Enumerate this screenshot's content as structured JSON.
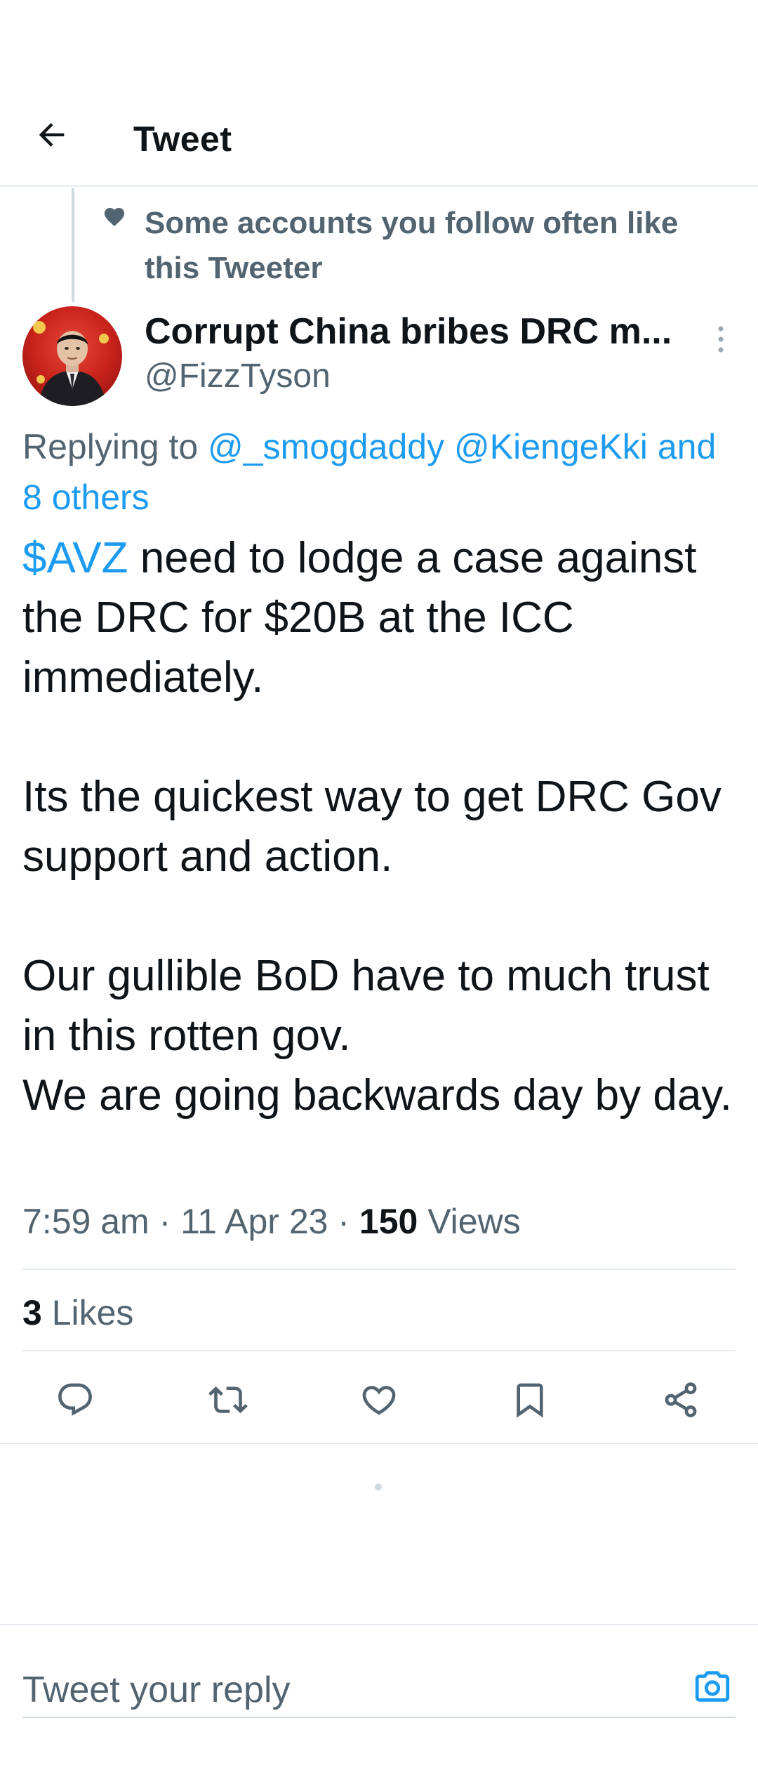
{
  "header": {
    "title": "Tweet"
  },
  "social_context": {
    "text": "Some accounts you follow often like this Tweeter",
    "icon": "heart-icon"
  },
  "author": {
    "name": "Corrupt China bribes DRC m...",
    "handle": "@FizzTyson"
  },
  "replying_to": {
    "prefix": "Replying to ",
    "mentions": [
      "@_smogdaddy",
      "@KiengeKki"
    ],
    "others": "and 8 others"
  },
  "tweet": {
    "cashtag": "$AVZ",
    "line1_rest": " need to lodge a case against the DRC for $20B at the ICC immediately.",
    "para2": "Its the quickest way to get DRC Gov support and action.",
    "para3a": "Our gullible BoD have to much trust in this rotten gov.",
    "para3b": "We are going backwards day by day."
  },
  "meta": {
    "time": "7:59 am",
    "date": "11 Apr 23",
    "separator": " · ",
    "views_count": "150",
    "views_label": " Views"
  },
  "likes": {
    "count": "3",
    "label": " Likes"
  },
  "actions": {
    "icons": [
      "reply-icon",
      "retweet-icon",
      "like-icon",
      "bookmark-icon",
      "share-icon"
    ]
  },
  "reply": {
    "placeholder": "Tweet your reply"
  },
  "colors": {
    "accent": "#1d9bf0",
    "text": "#0f1419",
    "secondary": "#536471",
    "border": "#e6ecf0"
  }
}
